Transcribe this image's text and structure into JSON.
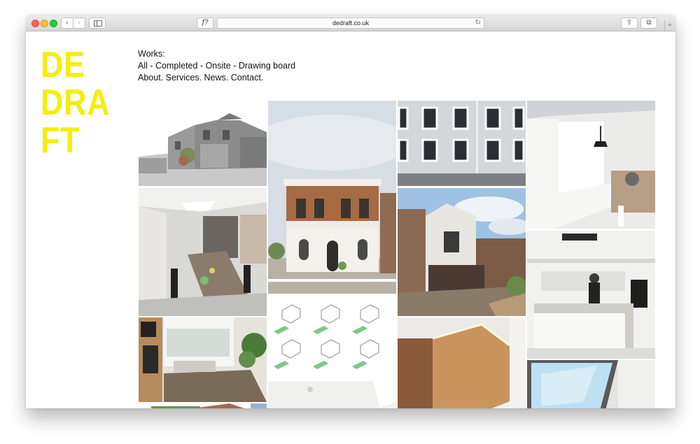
{
  "browser": {
    "url": "dedraft.co.uk",
    "font_button": "f?",
    "back_label": "‹",
    "forward_label": "›",
    "reload_label": "↻",
    "share_label": "⇧",
    "tabs_label": "⧉",
    "new_tab_label": "+",
    "icons": [
      "chevron-left-icon",
      "chevron-right-icon",
      "sidebar-icon",
      "reload-icon",
      "share-icon",
      "tabs-icon",
      "plus-icon"
    ]
  },
  "logo": {
    "lines": [
      "DE",
      "DRA",
      "FT"
    ],
    "color": "#f5ee0a"
  },
  "nav": {
    "works_label": "Works:",
    "filters": [
      "All",
      "Completed",
      "Onsite",
      "Drawing board"
    ],
    "filter_sep": " - ",
    "links": [
      "About.",
      "Services.",
      "News.",
      "Contact."
    ]
  },
  "colors": {
    "logo": "#f5ee0a",
    "text": "#111111",
    "accent_green": "#7ec88a"
  }
}
